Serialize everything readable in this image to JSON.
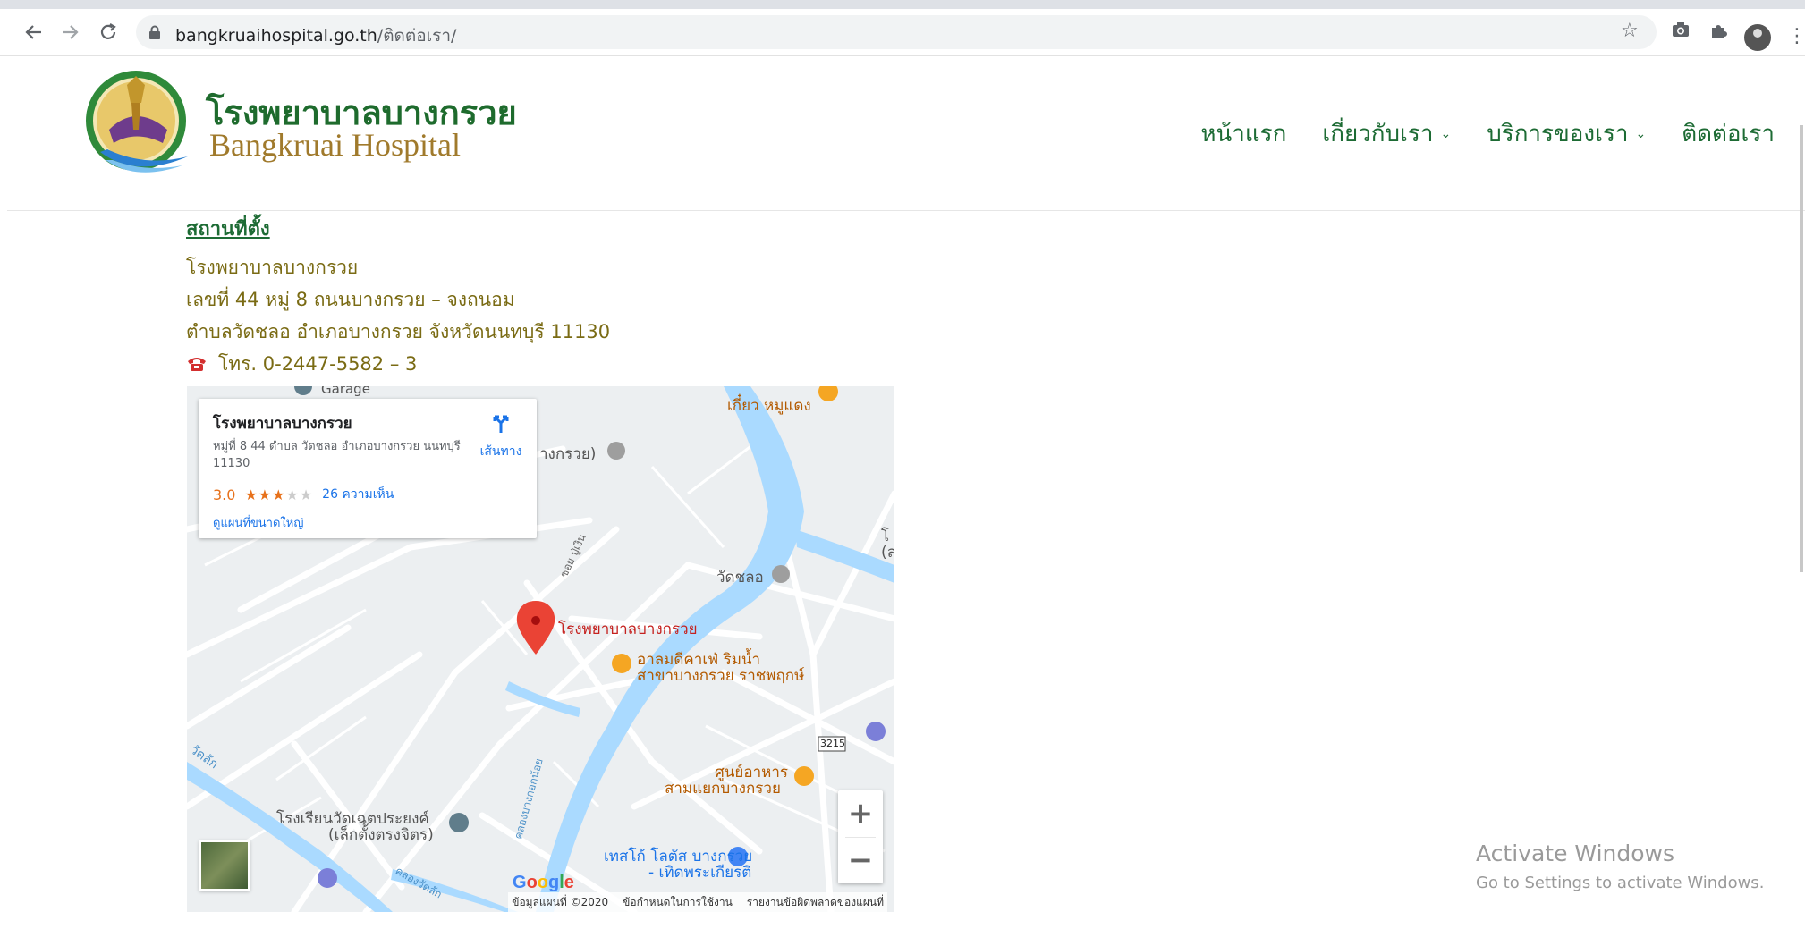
{
  "browser": {
    "url_domain": "bangkruaihospital.go.th",
    "url_path": "/ติดต่อเรา/"
  },
  "site": {
    "brand_th": "โรงพยาบาลบางกรวย",
    "brand_en": "Bangkruai Hospital",
    "nav": [
      {
        "label": "หน้าแรก",
        "has_dropdown": false
      },
      {
        "label": "เกี่ยวกับเรา",
        "has_dropdown": true
      },
      {
        "label": "บริการของเรา",
        "has_dropdown": true
      },
      {
        "label": "ติดต่อเรา",
        "has_dropdown": false
      }
    ]
  },
  "contact": {
    "title": "สถานที่ตั้ง",
    "line1": "โรงพยาบาลบางกรวย",
    "line2": "เลขที่ 44 หมู่ 8 ถนนบางกรวย – จงถนอม",
    "line3": "ตำบลวัดชลอ อำเภอบางกรวย  จังหวัดนนทบุรี 11130",
    "phone": "โทร. 0-2447-5582 – 3"
  },
  "map": {
    "card": {
      "name": "โรงพยาบาลบางกรวย",
      "address": "หมู่ที่ 8 44 ตำบล วัดชลอ อำเภอบางกรวย นนทบุรี 11130",
      "rating": "3.0",
      "stars_on": "★★★",
      "stars_off": "★★",
      "reviews": "26 ความเห็น",
      "larger_map": "ดูแผนที่ขนาดใหญ่",
      "directions": "เส้นทาง"
    },
    "labels": {
      "hospital": "โรงพยาบาลบางกรวย",
      "wat_chalo": "วัดชลอ",
      "cafe1": "อาลมดีคาเฟ่ ริมน้ำ",
      "cafe2": "สาขาบางกรวย ราชพฤกษ์",
      "food1": "ศูนย์อาหาร",
      "food2": "สามแยกบางกรวย",
      "school1": "โรงเรียนวัดเฉตประยงค์",
      "school2": "(เล็กตั้งตรงจิตร)",
      "tesco1": "เทสโก้ โลตัส บางกรวย",
      "tesco2": "- เทิดพระเกียรติ",
      "noodle": "เกี๋ยว หมูแดง",
      "road_3215": "3215",
      "top_left": "Garage",
      "temple_top": "างกรวย)",
      "right_edge1": "โ",
      "right_edge2": "(ล",
      "canal_left": "วัดลัก",
      "soi": "ซอย ปู่เงิน",
      "canal_bottom": "คลองวัดลัก",
      "canal_main": "คลองบางกอกน้อย"
    },
    "google": [
      "G",
      "o",
      "o",
      "g",
      "l",
      "e"
    ],
    "attribution": [
      "ข้อมูลแผนที่ ©2020",
      "ข้อกำหนดในการใช้งาน",
      "รายงานข้อผิดพลาดของแผนที่"
    ],
    "zoom_in": "+",
    "zoom_out": "−"
  },
  "watermark": {
    "title": "Activate Windows",
    "subtitle": "Go to Settings to activate Windows."
  },
  "colors": {
    "brand_green": "#1d6b34",
    "brand_gold": "#a07a2c",
    "address_text": "#7a6b14",
    "map_water": "#aadaff",
    "map_pin": "#ea4335"
  }
}
